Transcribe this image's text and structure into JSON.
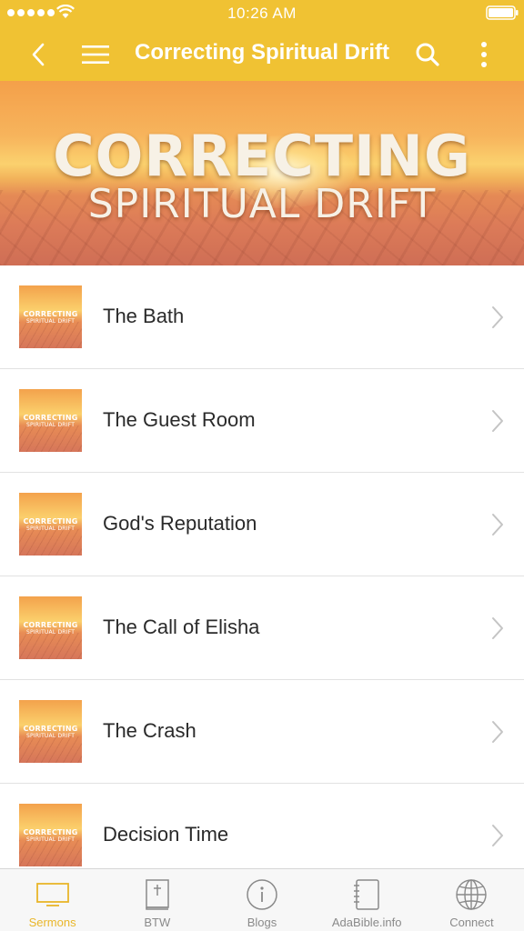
{
  "status_bar": {
    "time": "10:26 AM",
    "signal_icon": "signal-dots-icon",
    "wifi_icon": "wifi-icon",
    "battery_icon": "battery-icon"
  },
  "nav": {
    "title": "Correcting Spiritual Drift",
    "back_icon": "chevron-left-icon",
    "menu_icon": "hamburger-menu-icon",
    "search_icon": "search-icon",
    "more_icon": "more-vertical-icon"
  },
  "banner": {
    "line1": "CORRECTING",
    "line2": "SPIRITUAL DRIFT"
  },
  "thumbnail": {
    "line1": "CORRECTING",
    "line2": "SPIRITUAL DRIFT"
  },
  "sermons": [
    {
      "title": "The Bath"
    },
    {
      "title": "The Guest Room"
    },
    {
      "title": "God's Reputation"
    },
    {
      "title": "The Call of Elisha"
    },
    {
      "title": "The Crash"
    },
    {
      "title": "Decision Time"
    }
  ],
  "tabs": [
    {
      "label": "Sermons",
      "icon": "tv-icon",
      "active": true
    },
    {
      "label": "BTW",
      "icon": "bible-icon",
      "active": false
    },
    {
      "label": "Blogs",
      "icon": "info-icon",
      "active": false
    },
    {
      "label": "AdaBible.info",
      "icon": "notebook-icon",
      "active": false
    },
    {
      "label": "Connect",
      "icon": "globe-icon",
      "active": false
    }
  ],
  "colors": {
    "accent": "#F0C233",
    "active_tab": "#E9B62A",
    "inactive_tab": "#8A8A8A"
  }
}
